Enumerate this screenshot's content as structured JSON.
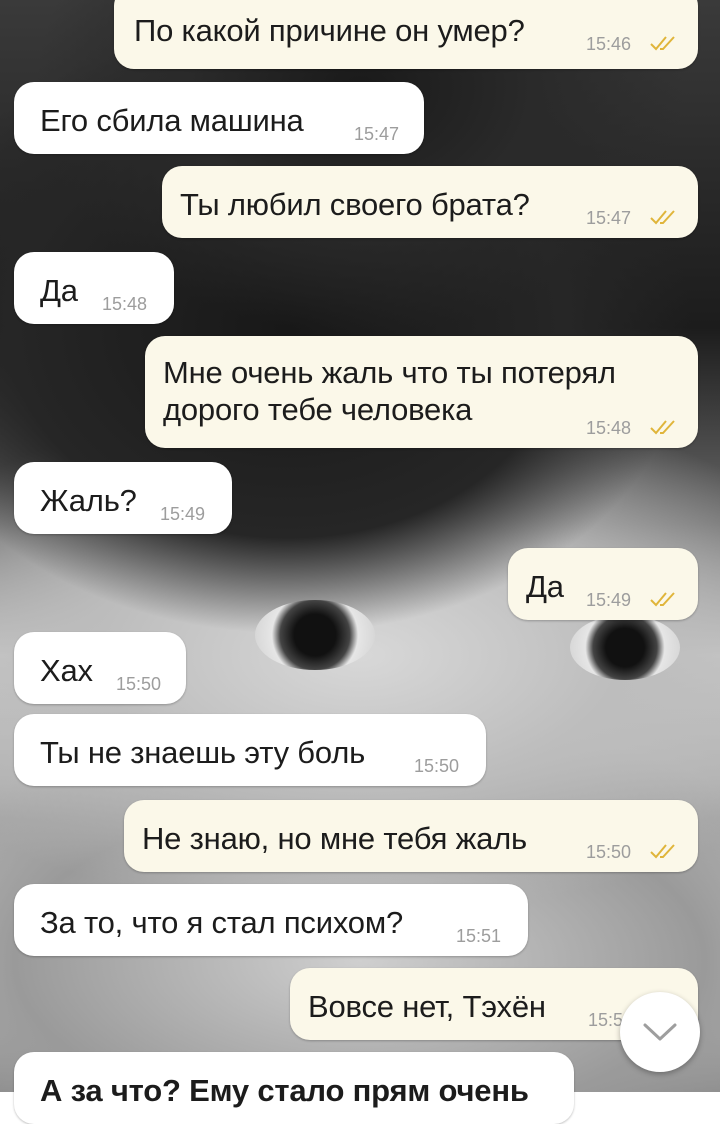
{
  "messages": [
    {
      "dir": "out",
      "text": "По какой причине он умер?",
      "time": "15:46",
      "read": true
    },
    {
      "dir": "in",
      "text": "Его сбила машина",
      "time": "15:47"
    },
    {
      "dir": "out",
      "text": "Ты любил своего брата?",
      "time": "15:47",
      "read": true
    },
    {
      "dir": "in",
      "text": "Да",
      "time": "15:48"
    },
    {
      "dir": "out",
      "text": "Мне очень жаль что ты потерял\nдорого тебе человека",
      "time": "15:48",
      "read": true
    },
    {
      "dir": "in",
      "text": "Жаль?",
      "time": "15:49"
    },
    {
      "dir": "out",
      "text": "Да",
      "time": "15:49",
      "read": true
    },
    {
      "dir": "in",
      "text": "Хах",
      "time": "15:50"
    },
    {
      "dir": "in",
      "text": "Ты не знаешь эту боль",
      "time": "15:50"
    },
    {
      "dir": "out",
      "text": "Не знаю, но мне тебя жаль",
      "time": "15:50",
      "read": true
    },
    {
      "dir": "in",
      "text": "За то, что я стал психом?",
      "time": "15:51"
    },
    {
      "dir": "out",
      "text": "Вовсе нет, Тэхён",
      "time": "15:5",
      "read": true
    },
    {
      "dir": "in",
      "text": "А за что? Ему стало прям очень",
      "time": ""
    }
  ],
  "scroll_button": {
    "icon": "chevron-down-icon"
  },
  "colors": {
    "incoming": "#ffffff",
    "outgoing": "#fbf8e9",
    "time": "#9d9d9d",
    "check": "#e0b53a"
  }
}
